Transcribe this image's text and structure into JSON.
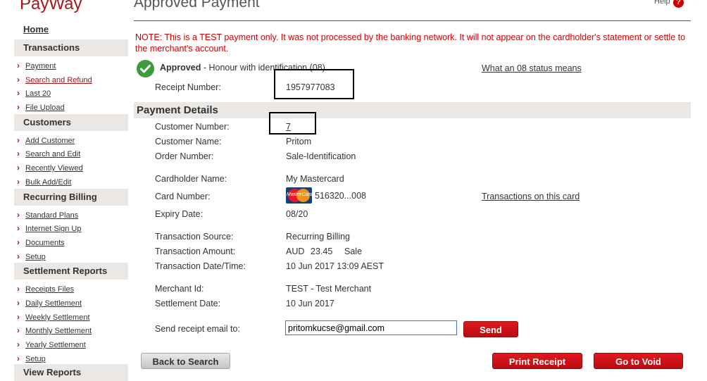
{
  "sidebar": {
    "brand": "PayWay",
    "home": "Home",
    "sections": [
      {
        "title": "Transactions",
        "items": [
          {
            "label": "Payment"
          },
          {
            "label": "Search and Refund",
            "active": true
          },
          {
            "label": "Last 20"
          },
          {
            "label": "File Upload"
          }
        ]
      },
      {
        "title": "Customers",
        "items": [
          {
            "label": "Add Customer"
          },
          {
            "label": "Search and Edit"
          },
          {
            "label": "Recently Viewed"
          },
          {
            "label": "Bulk Add/Edit"
          }
        ]
      },
      {
        "title": "Recurring Billing",
        "items": [
          {
            "label": "Standard Plans"
          },
          {
            "label": "Internet Sign Up"
          },
          {
            "label": "Documents"
          },
          {
            "label": "Setup"
          }
        ]
      },
      {
        "title": "Settlement Reports",
        "items": [
          {
            "label": "Receipts Files"
          },
          {
            "label": "Daily Settlement"
          },
          {
            "label": "Weekly Settlement"
          },
          {
            "label": "Monthly Settlement"
          },
          {
            "label": "Yearly Settlement"
          },
          {
            "label": "Setup"
          }
        ]
      },
      {
        "title": "View Reports",
        "items": []
      }
    ]
  },
  "header": {
    "title": "Approved Payment",
    "help": "Help",
    "help_icon": "?"
  },
  "note": "NOTE: This is a TEST payment only. It was not processed by the banking network. It will not appear on the cardholder's statement or settle to the merchant's account.",
  "status": {
    "label": "Approved",
    "detail": "- Honour with identification (08)",
    "link": "What an 08 status means",
    "icon": "check-circle-icon"
  },
  "receipt": {
    "label": "Receipt Number:",
    "value": "1957977083"
  },
  "payment_details": {
    "heading": "Payment Details",
    "customer_number": {
      "label": "Customer Number:",
      "value": "7"
    },
    "customer_name": {
      "label": "Customer Name:",
      "value": "Pritom"
    },
    "order_number": {
      "label": "Order Number:",
      "value": "Sale-Identification"
    },
    "cardholder_name": {
      "label": "Cardholder Name:",
      "value": "My Mastercard"
    },
    "card_number": {
      "label": "Card Number:",
      "value": "516320...008",
      "brand_icon": "mastercard-icon",
      "brand_text": "MasterCard",
      "link": "Transactions on this card"
    },
    "expiry_date": {
      "label": "Expiry Date:",
      "value": "08/20"
    },
    "transaction_source": {
      "label": "Transaction Source:",
      "value": "Recurring Billing"
    },
    "transaction_amount": {
      "label": "Transaction Amount:",
      "currency": "AUD",
      "amount": "23.45",
      "type": "Sale"
    },
    "transaction_datetime": {
      "label": "Transaction Date/Time:",
      "value": "10 Jun 2017 13:09 AEST"
    },
    "merchant_id": {
      "label": "Merchant Id:",
      "value": "TEST - Test Merchant"
    },
    "settlement_date": {
      "label": "Settlement Date:",
      "value": "10 Jun 2017"
    }
  },
  "email": {
    "label": "Send receipt email to:",
    "value": "pritomkucse@gmail.com",
    "send_button": "Send"
  },
  "actions": {
    "back": "Back to Search",
    "print": "Print Receipt",
    "void": "Go to Void"
  },
  "colors": {
    "brand_red": "#a9141b",
    "note_red": "#d10000",
    "section_bg": "#eae7e4",
    "approved_green": "#3d9a3d"
  }
}
